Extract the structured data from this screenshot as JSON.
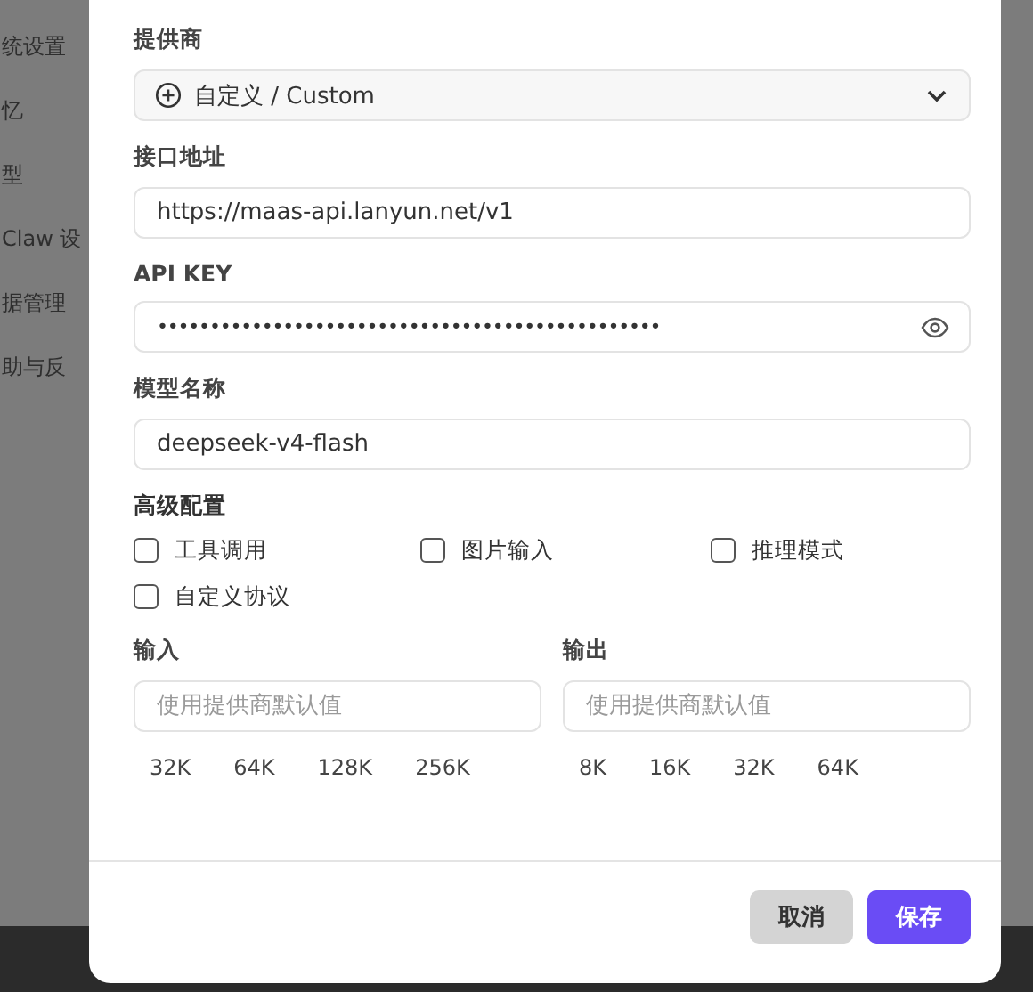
{
  "sidebar": {
    "items": [
      {
        "label": "统设置"
      },
      {
        "label": "忆"
      },
      {
        "label": "型"
      },
      {
        "label": "Claw 设"
      },
      {
        "label": "据管理"
      },
      {
        "label": "助与反"
      }
    ]
  },
  "dialog": {
    "fields": [
      {
        "kind": "select",
        "label": "提供商",
        "value": "自定义 / Custom"
      },
      {
        "kind": "text",
        "label": "接口地址",
        "value": "https://maas-api.lanyun.net/v1"
      },
      {
        "kind": "password",
        "label": "API KEY",
        "value": "••••••••••••••••••••••••••••••••••••••••••••••••"
      },
      {
        "kind": "text",
        "label": "模型名称",
        "value": "deepseek-v4-flash"
      }
    ],
    "advanced": {
      "title": "高级配置",
      "options": [
        {
          "label": "工具调用",
          "checked": false
        },
        {
          "label": "图片输入",
          "checked": false
        },
        {
          "label": "推理模式",
          "checked": false
        },
        {
          "label": "自定义协议",
          "checked": false
        }
      ]
    },
    "limits": [
      {
        "label": "输入",
        "placeholder": "使用提供商默认值",
        "presets": [
          "32K",
          "64K",
          "128K",
          "256K"
        ]
      },
      {
        "label": "输出",
        "placeholder": "使用提供商默认值",
        "presets": [
          "8K",
          "16K",
          "32K",
          "64K"
        ]
      }
    ],
    "buttons": [
      {
        "label": "取消",
        "kind": "secondary"
      },
      {
        "label": "保存",
        "kind": "primary"
      }
    ]
  }
}
